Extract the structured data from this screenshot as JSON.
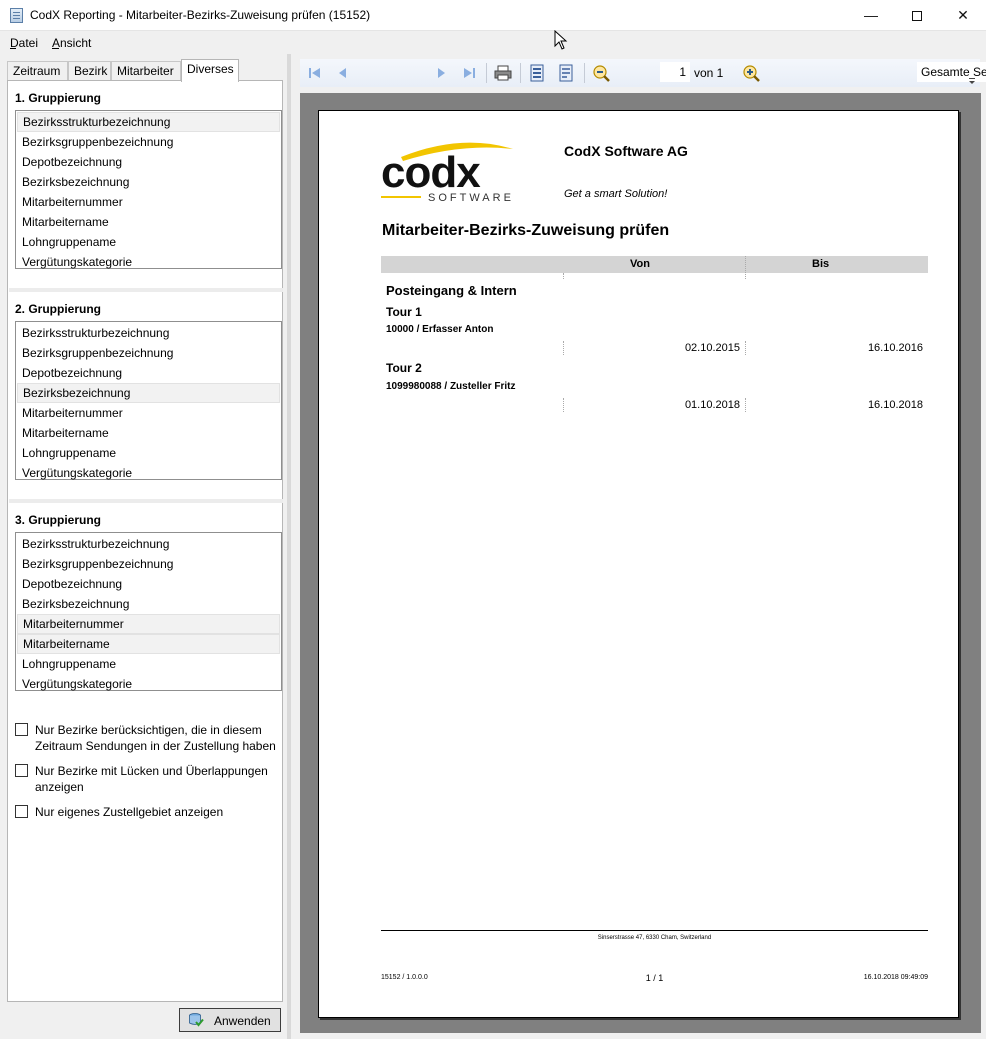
{
  "window": {
    "title": "CodX Reporting - Mitarbeiter-Bezirks-Zuweisung prüfen (15152)",
    "minimize": "—",
    "close": "✕"
  },
  "menu": {
    "datei": "Datei",
    "ansicht": "Ansicht"
  },
  "tabs": [
    "Zeitraum",
    "Bezirk",
    "Mitarbeiter",
    "Diverses"
  ],
  "active_tab": "Diverses",
  "groups": [
    {
      "title": "1. Gruppierung",
      "items": [
        "Bezirksstrukturbezeichnung",
        "Bezirksgruppenbezeichnung",
        "Depotbezeichnung",
        "Bezirksbezeichnung",
        "Mitarbeiternummer",
        "Mitarbeitername",
        "Lohngruppename",
        "Vergütungskategorie"
      ],
      "selected": "Bezirksstrukturbezeichnung"
    },
    {
      "title": "2. Gruppierung",
      "items": [
        "Bezirksstrukturbezeichnung",
        "Bezirksgruppenbezeichnung",
        "Depotbezeichnung",
        "Bezirksbezeichnung",
        "Mitarbeiternummer",
        "Mitarbeitername",
        "Lohngruppename",
        "Vergütungskategorie"
      ],
      "selected": "Bezirksbezeichnung"
    },
    {
      "title": "3. Gruppierung",
      "items": [
        "Bezirksstrukturbezeichnung",
        "Bezirksgruppenbezeichnung",
        "Depotbezeichnung",
        "Bezirksbezeichnung",
        "Mitarbeiternummer",
        "Mitarbeitername",
        "Lohngruppename",
        "Vergütungskategorie"
      ],
      "selected": [
        "Mitarbeiternummer",
        "Mitarbeitername"
      ]
    }
  ],
  "options": [
    {
      "label": "Nur Bezirke berücksichtigen, die in diesem Zeitraum Sendungen in der Zustellung haben",
      "checked": false
    },
    {
      "label": "Nur Bezirke mit Lücken und Überlappungen anzeigen",
      "checked": false
    },
    {
      "label": "Nur eigenes Zustellgebiet anzeigen",
      "checked": false
    }
  ],
  "apply_button": "Anwenden",
  "toolbar": {
    "page_current": "1",
    "page_of": "von 1",
    "zoom": "Gesamte Seite",
    "icons": [
      "first-page-icon",
      "prev-page-icon",
      "next-page-icon",
      "last-page-icon",
      "print-icon",
      "export-icon",
      "page-setup-icon",
      "zoom-out-icon",
      "zoom-in-icon"
    ]
  },
  "report": {
    "company": "CodX Software AG",
    "slogan": "Get a smart Solution!",
    "logo_text": "codx",
    "logo_sub": "SOFTWARE",
    "title": "Mitarbeiter-Bezirks-Zuweisung prüfen",
    "col_von": "Von",
    "col_bis": "Bis",
    "group": "Posteingang & Intern",
    "tours": [
      {
        "tour": "Tour 1",
        "employee": "10000 / Erfasser Anton",
        "von": "02.10.2015",
        "bis": "16.10.2016"
      },
      {
        "tour": "Tour 2",
        "employee": "1099980088 / Zusteller  Fritz",
        "von": "01.10.2018",
        "bis": "16.10.2018"
      }
    ],
    "footer_address": "Sinserstrasse 47, 6330 Cham, Switzerland",
    "footer_left": "15152 / 1.0.0.0",
    "footer_center": "1 / 1",
    "footer_right": "16.10.2018 09:49:09"
  }
}
